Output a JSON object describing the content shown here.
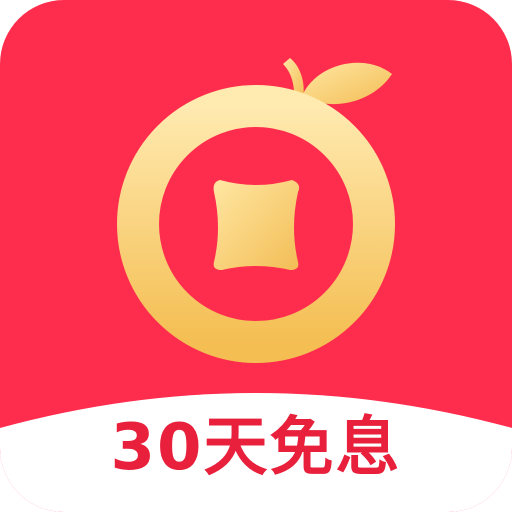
{
  "app_icon": {
    "banner_text": "30天免息",
    "colors": {
      "background": "#ff2d4d",
      "banner": "#ffffff",
      "banner_text": "#e8203c",
      "coin_gold_light": "#ffe7a3",
      "coin_gold_dark": "#f5c25a"
    },
    "icon": "gold-coin-fruit-icon"
  }
}
